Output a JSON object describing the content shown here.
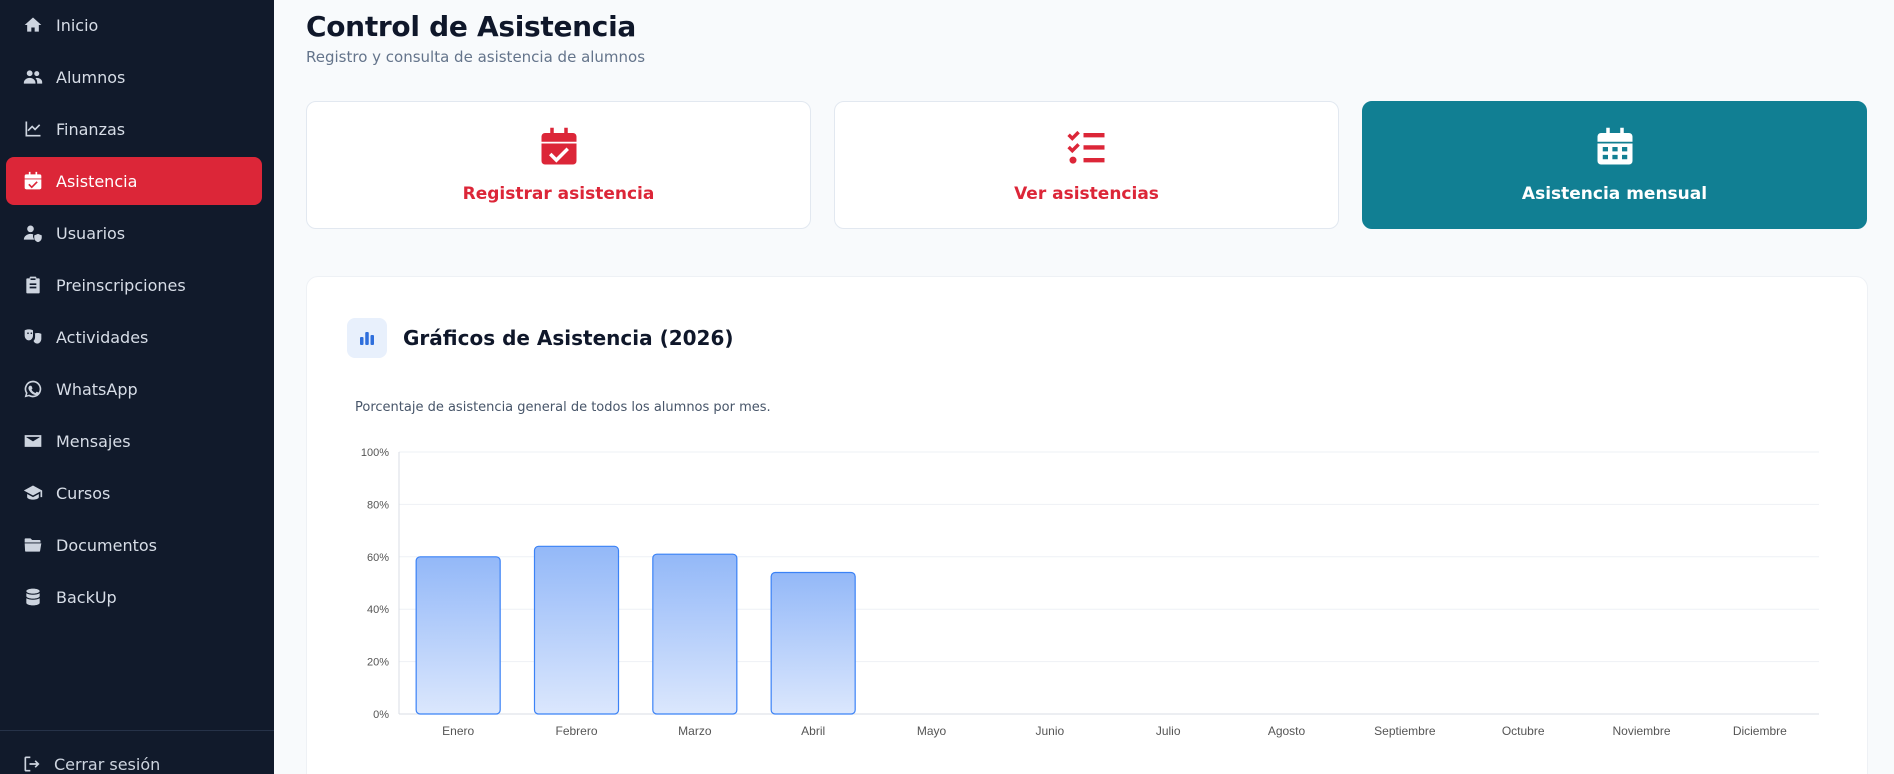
{
  "sidebar": {
    "items": [
      {
        "label": "Inicio",
        "icon": "home-icon"
      },
      {
        "label": "Alumnos",
        "icon": "users-icon"
      },
      {
        "label": "Finanzas",
        "icon": "chart-line-icon"
      },
      {
        "label": "Asistencia",
        "icon": "calendar-check-icon",
        "active": true
      },
      {
        "label": "Usuarios",
        "icon": "user-shield-icon"
      },
      {
        "label": "Preinscripciones",
        "icon": "clipboard-icon"
      },
      {
        "label": "Actividades",
        "icon": "masks-icon"
      },
      {
        "label": "WhatsApp",
        "icon": "whatsapp-icon"
      },
      {
        "label": "Mensajes",
        "icon": "envelope-icon"
      },
      {
        "label": "Cursos",
        "icon": "graduation-cap-icon"
      },
      {
        "label": "Documentos",
        "icon": "folder-icon"
      },
      {
        "label": "BackUp",
        "icon": "database-icon"
      }
    ],
    "logout_label": "Cerrar sesión"
  },
  "header": {
    "title": "Control de Asistencia",
    "subtitle": "Registro y consulta de asistencia de alumnos"
  },
  "actions": [
    {
      "label": "Registrar asistencia",
      "icon": "calendar-check-icon"
    },
    {
      "label": "Ver asistencias",
      "icon": "list-check-icon"
    },
    {
      "label": "Asistencia mensual",
      "icon": "calendar-grid-icon",
      "active": true
    }
  ],
  "panel": {
    "title": "Gráficos de Asistencia (2026)",
    "description": "Porcentaje de asistencia general de todos los alumnos por mes."
  },
  "colors": {
    "sidebar_bg": "#111a2b",
    "accent_red": "#dc2638",
    "accent_teal": "#117f93",
    "bar_fill_top": "#93b8f8",
    "bar_fill_bottom": "#dbe7fd",
    "bar_stroke": "#3b82f6"
  },
  "chart_data": {
    "type": "bar",
    "categories": [
      "Enero",
      "Febrero",
      "Marzo",
      "Abril",
      "Mayo",
      "Junio",
      "Julio",
      "Agosto",
      "Septiembre",
      "Octubre",
      "Noviembre",
      "Diciembre"
    ],
    "values": [
      60,
      64,
      61,
      54,
      null,
      null,
      null,
      null,
      null,
      null,
      null,
      null
    ],
    "ylim": [
      0,
      100
    ],
    "yticks": [
      "0%",
      "20%",
      "40%",
      "60%",
      "80%",
      "100%"
    ],
    "grid": true,
    "legend": "none"
  }
}
